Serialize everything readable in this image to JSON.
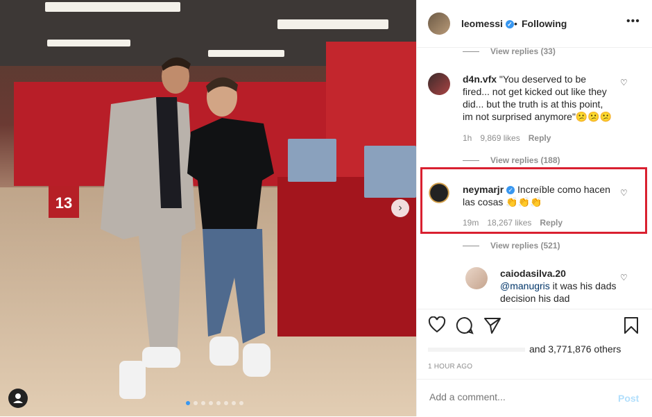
{
  "header": {
    "username": "leomessi",
    "separator": "•",
    "follow_label": "Following",
    "more": "•••"
  },
  "comments": {
    "view_replies_top": "View replies (33)",
    "c1": {
      "user": "d4n.vfx",
      "text": "\"You deserved to be fired... not get kicked out like they did... but the truth is at this point, im not surprised anymore\"😕😕😕",
      "time": "1h",
      "likes": "9,869 likes",
      "reply": "Reply"
    },
    "view_replies_1": "View replies (188)",
    "c2": {
      "user": "neymarjr",
      "text": "Incrеíble como hacen las cosas 👏👏👏",
      "time": "19m",
      "likes": "18,267 likes",
      "reply": "Reply"
    },
    "view_replies_2": "View replies (521)",
    "c3": {
      "user": "caiodasilva.20",
      "mention": "@manugris",
      "text": " it was his dads decision his dad"
    }
  },
  "actions": {
    "likes_tail": "and 3,771,876 others",
    "time_ago": "1 HOUR AGO"
  },
  "add_comment": {
    "placeholder": "Add a comment...",
    "post_label": "Post"
  },
  "photo": {
    "locker_number": "13",
    "carousel_count": 8,
    "carousel_active": 1
  },
  "colors": {
    "highlight": "#d92030",
    "link": "#3897f0"
  }
}
